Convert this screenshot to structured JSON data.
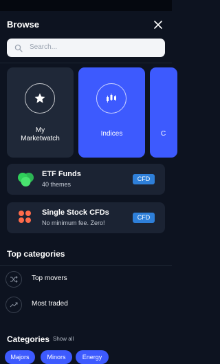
{
  "header": {
    "title": "Browse"
  },
  "search": {
    "placeholder": "Search..."
  },
  "tiles": [
    {
      "label": "My\nMarketwatch",
      "icon": "star-icon"
    },
    {
      "label": "Indices",
      "icon": "candlestick-chart-icon"
    },
    {
      "label": "C",
      "icon": ""
    }
  ],
  "cards": [
    {
      "title": "ETF Funds",
      "subtitle": "40 themes",
      "badge": "CFD",
      "icon": "etf-circles-icon",
      "color": "#2fcf5a"
    },
    {
      "title": "Single Stock CFDs",
      "subtitle": "No minimum fee. Zero!",
      "badge": "CFD",
      "icon": "stock-dots-icon",
      "color": "#ff6b4a"
    }
  ],
  "top_categories": {
    "title": "Top categories",
    "items": [
      {
        "label": "Top movers",
        "icon": "shuffle-icon"
      },
      {
        "label": "Most traded",
        "icon": "trend-up-icon"
      }
    ]
  },
  "categories": {
    "title": "Categories",
    "show_all": "Show all",
    "chips": [
      "Majors",
      "Minors",
      "Energy"
    ]
  }
}
